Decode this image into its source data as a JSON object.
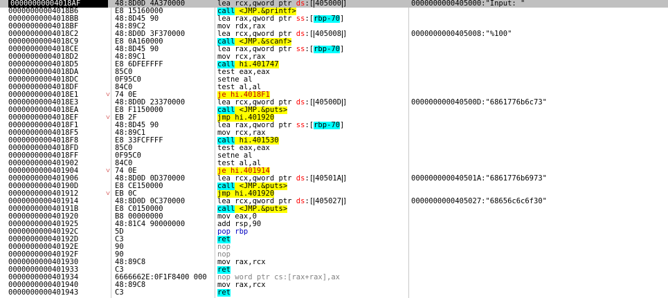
{
  "rows": [
    {
      "addr": "00000000004018AF",
      "bytes": "48:8D0D 4A370000",
      "mark": "",
      "instr": [
        {
          "t": "lea rcx,qword ptr "
        },
        {
          "t": "ds",
          "c": "seg"
        },
        {
          "t": ":["
        },
        {
          "t": "405000",
          "c": "box"
        },
        {
          "t": "]"
        }
      ],
      "comment": "0000000000405000:\"Input: \"",
      "selected": true
    },
    {
      "addr": "00000000004018B6",
      "bytes": "E8 15160000",
      "mark": "",
      "instr": [
        {
          "t": "call <JMP.&printf>",
          "c": "hl-cyan-yellow"
        }
      ],
      "comment": ""
    },
    {
      "addr": "00000000004018BB",
      "bytes": "48:8D45 90",
      "mark": "",
      "instr": [
        {
          "t": "lea rax,qword ptr "
        },
        {
          "t": "ss",
          "c": "seg"
        },
        {
          "t": ":["
        },
        {
          "t": "rbp-70",
          "c": "hl-cyan"
        },
        {
          "t": "]"
        }
      ],
      "comment": ""
    },
    {
      "addr": "00000000004018BF",
      "bytes": "48:89C2",
      "mark": "",
      "instr": [
        {
          "t": "mov rdx,rax"
        }
      ],
      "comment": ""
    },
    {
      "addr": "00000000004018C2",
      "bytes": "48:8D0D 3F370000",
      "mark": "",
      "instr": [
        {
          "t": "lea rcx,qword ptr "
        },
        {
          "t": "ds",
          "c": "seg"
        },
        {
          "t": ":["
        },
        {
          "t": "405008",
          "c": "box"
        },
        {
          "t": "]"
        }
      ],
      "comment": "0000000000405008:\"%100\""
    },
    {
      "addr": "00000000004018C9",
      "bytes": "E8 0A160000",
      "mark": "",
      "instr": [
        {
          "t": "call <JMP.&scanf>",
          "c": "hl-cyan-yellow"
        }
      ],
      "comment": ""
    },
    {
      "addr": "00000000004018CE",
      "bytes": "48:8D45 90",
      "mark": "",
      "instr": [
        {
          "t": "lea rax,qword ptr "
        },
        {
          "t": "ss",
          "c": "seg"
        },
        {
          "t": ":["
        },
        {
          "t": "rbp-70",
          "c": "hl-cyan"
        },
        {
          "t": "]"
        }
      ],
      "comment": ""
    },
    {
      "addr": "00000000004018D2",
      "bytes": "48:89C1",
      "mark": "",
      "instr": [
        {
          "t": "mov rcx,rax"
        }
      ],
      "comment": ""
    },
    {
      "addr": "00000000004018D5",
      "bytes": "E8 6DFEFFFF",
      "mark": "",
      "instr": [
        {
          "t": "call hi.401747",
          "c": "hl-cyan-yellow"
        }
      ],
      "comment": ""
    },
    {
      "addr": "00000000004018DA",
      "bytes": "85C0",
      "mark": "",
      "instr": [
        {
          "t": "test eax,eax"
        }
      ],
      "comment": ""
    },
    {
      "addr": "00000000004018DC",
      "bytes": "0F95C0",
      "mark": "",
      "instr": [
        {
          "t": "setne al"
        }
      ],
      "comment": ""
    },
    {
      "addr": "00000000004018DF",
      "bytes": "84C0",
      "mark": "",
      "instr": [
        {
          "t": "test al,al"
        }
      ],
      "comment": ""
    },
    {
      "addr": "00000000004018E1",
      "bytes": "74 0E",
      "mark": "˅",
      "instr": [
        {
          "t": "je hi.4018F1",
          "c": "hl-yellow-red"
        }
      ],
      "comment": ""
    },
    {
      "addr": "00000000004018E3",
      "bytes": "48:8D0D 23370000",
      "mark": "",
      "instr": [
        {
          "t": "lea rcx,qword ptr "
        },
        {
          "t": "ds",
          "c": "seg"
        },
        {
          "t": ":["
        },
        {
          "t": "40500D",
          "c": "box"
        },
        {
          "t": "]"
        }
      ],
      "comment": "000000000040500D:\"6861776b6c73\""
    },
    {
      "addr": "00000000004018EA",
      "bytes": "E8 F1150000",
      "mark": "",
      "instr": [
        {
          "t": "call <JMP.&puts>",
          "c": "hl-cyan-yellow"
        }
      ],
      "comment": ""
    },
    {
      "addr": "00000000004018EF",
      "bytes": "EB 2F",
      "mark": "˅",
      "instr": [
        {
          "t": "jmp hi.401920",
          "c": "hl-yellow"
        }
      ],
      "comment": ""
    },
    {
      "addr": "00000000004018F1",
      "bytes": "48:8D45 90",
      "mark": "",
      "instr": [
        {
          "t": "lea rax,qword ptr "
        },
        {
          "t": "ss",
          "c": "seg"
        },
        {
          "t": ":["
        },
        {
          "t": "rbp-70",
          "c": "hl-cyan"
        },
        {
          "t": "]"
        }
      ],
      "comment": ""
    },
    {
      "addr": "00000000004018F5",
      "bytes": "48:89C1",
      "mark": "",
      "instr": [
        {
          "t": "mov rcx,rax"
        }
      ],
      "comment": ""
    },
    {
      "addr": "00000000004018F8",
      "bytes": "E8 33FCFFFF",
      "mark": "",
      "instr": [
        {
          "t": "call hi.401530",
          "c": "hl-cyan-yellow"
        }
      ],
      "comment": ""
    },
    {
      "addr": "00000000004018FD",
      "bytes": "85C0",
      "mark": "",
      "instr": [
        {
          "t": "test eax,eax"
        }
      ],
      "comment": ""
    },
    {
      "addr": "00000000004018FF",
      "bytes": "0F95C0",
      "mark": "",
      "instr": [
        {
          "t": "setne al"
        }
      ],
      "comment": ""
    },
    {
      "addr": "0000000000401902",
      "bytes": "84C0",
      "mark": "",
      "instr": [
        {
          "t": "test al,al"
        }
      ],
      "comment": ""
    },
    {
      "addr": "0000000000401904",
      "bytes": "74 0E",
      "mark": "˅",
      "instr": [
        {
          "t": "je hi.401914",
          "c": "hl-yellow-red"
        }
      ],
      "comment": ""
    },
    {
      "addr": "0000000000401906",
      "bytes": "48:8D0D 0D370000",
      "mark": "",
      "instr": [
        {
          "t": "lea rcx,qword ptr "
        },
        {
          "t": "ds",
          "c": "seg"
        },
        {
          "t": ":["
        },
        {
          "t": "40501A",
          "c": "box"
        },
        {
          "t": "]"
        }
      ],
      "comment": "000000000040501A:\"6861776b6973\""
    },
    {
      "addr": "000000000040190D",
      "bytes": "E8 CE150000",
      "mark": "",
      "instr": [
        {
          "t": "call <JMP.&puts>",
          "c": "hl-cyan-yellow"
        }
      ],
      "comment": ""
    },
    {
      "addr": "0000000000401912",
      "bytes": "EB 0C",
      "mark": "˅",
      "instr": [
        {
          "t": "jmp hi.401920",
          "c": "hl-yellow"
        }
      ],
      "comment": ""
    },
    {
      "addr": "0000000000401914",
      "bytes": "48:8D0D 0C370000",
      "mark": "",
      "instr": [
        {
          "t": "lea rcx,qword ptr "
        },
        {
          "t": "ds",
          "c": "seg"
        },
        {
          "t": ":["
        },
        {
          "t": "405027",
          "c": "box"
        },
        {
          "t": "]"
        }
      ],
      "comment": "0000000000405027:\"68656c6c6f30\""
    },
    {
      "addr": "000000000040191B",
      "bytes": "E8 C0150000",
      "mark": "",
      "instr": [
        {
          "t": "call <JMP.&puts>",
          "c": "hl-cyan-yellow"
        }
      ],
      "comment": ""
    },
    {
      "addr": "0000000000401920",
      "bytes": "B8 00000000",
      "mark": "",
      "instr": [
        {
          "t": "mov eax,0"
        }
      ],
      "comment": ""
    },
    {
      "addr": "0000000000401925",
      "bytes": "48:81C4 90000000",
      "mark": "",
      "instr": [
        {
          "t": "add rsp,90"
        }
      ],
      "comment": ""
    },
    {
      "addr": "000000000040192C",
      "bytes": "5D",
      "mark": "",
      "instr": [
        {
          "t": "pop rbp",
          "c": "blue"
        }
      ],
      "comment": ""
    },
    {
      "addr": "000000000040192D",
      "bytes": "C3",
      "mark": "",
      "instr": [
        {
          "t": "ret",
          "c": "hl-cyan-only"
        }
      ],
      "comment": ""
    },
    {
      "addr": "000000000040192E",
      "bytes": "90",
      "mark": "",
      "instr": [
        {
          "t": "nop",
          "c": "gray"
        }
      ],
      "comment": ""
    },
    {
      "addr": "000000000040192F",
      "bytes": "90",
      "mark": "",
      "instr": [
        {
          "t": "nop",
          "c": "gray"
        }
      ],
      "comment": ""
    },
    {
      "addr": "0000000000401930",
      "bytes": "48:89C8",
      "mark": "",
      "instr": [
        {
          "t": "mov rax,rcx"
        }
      ],
      "comment": ""
    },
    {
      "addr": "0000000000401933",
      "bytes": "C3",
      "mark": "",
      "instr": [
        {
          "t": "ret",
          "c": "hl-cyan-only"
        }
      ],
      "comment": ""
    },
    {
      "addr": "0000000000401934",
      "bytes": "6666662E:0F1F8400 000",
      "mark": "",
      "instr": [
        {
          "t": "nop word ptr cs:[rax+rax],ax",
          "c": "gray"
        }
      ],
      "comment": ""
    },
    {
      "addr": "0000000000401940",
      "bytes": "48:89C8",
      "mark": "",
      "instr": [
        {
          "t": "mov rax,rcx"
        }
      ],
      "comment": ""
    },
    {
      "addr": "0000000000401943",
      "bytes": "C3",
      "mark": "",
      "instr": [
        {
          "t": "ret",
          "c": "hl-cyan-only"
        }
      ],
      "comment": ""
    }
  ]
}
